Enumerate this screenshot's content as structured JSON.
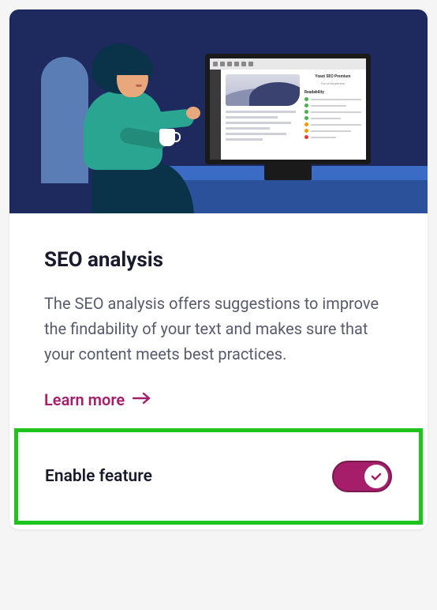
{
  "card": {
    "title": "SEO analysis",
    "description": "The SEO analysis offers suggestions to improve the findability of your text and makes sure that your content meets best practices.",
    "learn_more": "Learn more"
  },
  "footer": {
    "label": "Enable feature",
    "enabled": true
  },
  "illustration": {
    "monitor_brand": "Yoast SEO Premium",
    "monitor_sub": "Focus keyphrase",
    "readability_heading": "Readability"
  },
  "colors": {
    "accent": "#a61e69",
    "highlight_border": "#1ec31e",
    "illustration_bg": "#1e2a5e"
  }
}
